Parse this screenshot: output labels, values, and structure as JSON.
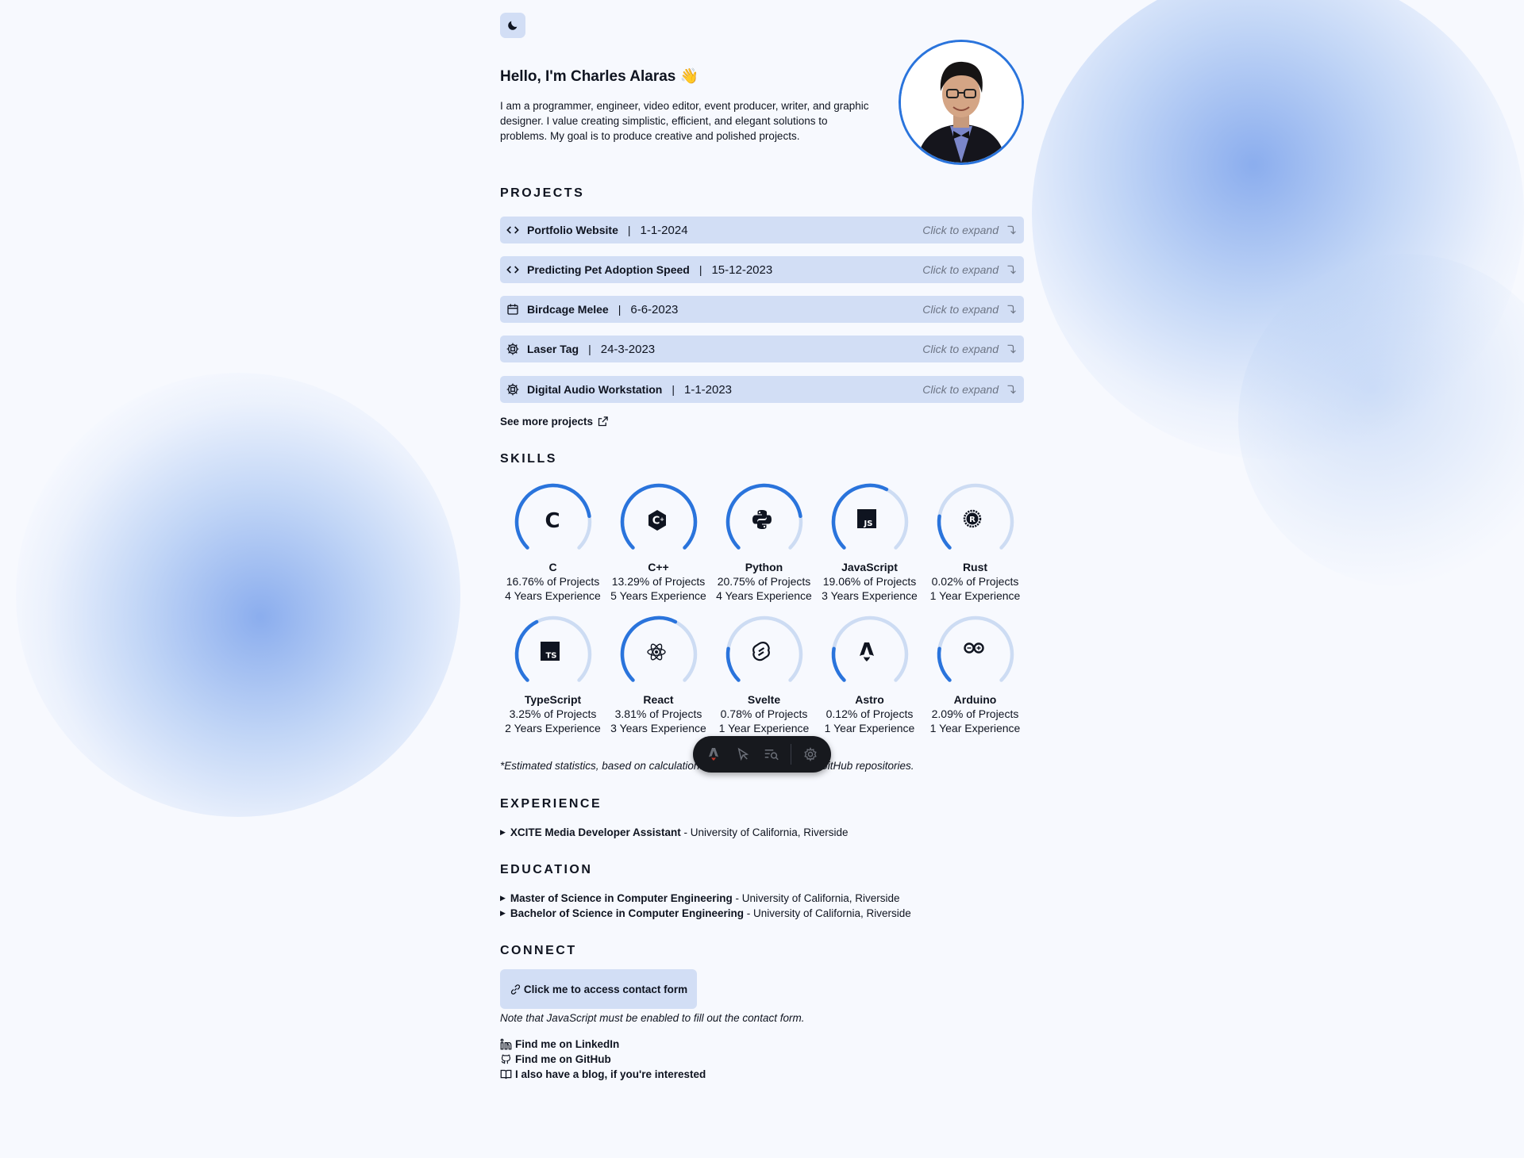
{
  "theme_toggle": {
    "icon": "moon-icon"
  },
  "intro": {
    "greeting": "Hello, I'm Charles Alaras",
    "wave": "👋",
    "bio": "I am a programmer, engineer, video editor, event producer, writer, and graphic designer. I value creating simplistic, efficient, and elegant solutions to problems. My goal is to produce creative and polished projects."
  },
  "projects": {
    "title": "PROJECTS",
    "expand_label": "Click to expand",
    "separator": "|",
    "items": [
      {
        "name": "Portfolio Website",
        "date": "1-1-2024",
        "icon": "code-icon"
      },
      {
        "name": "Predicting Pet Adoption Speed",
        "date": "15-12-2023",
        "icon": "code-icon"
      },
      {
        "name": "Birdcage Melee",
        "date": "6-6-2023",
        "icon": "calendar-icon"
      },
      {
        "name": "Laser Tag",
        "date": "24-3-2023",
        "icon": "cpu-icon"
      },
      {
        "name": "Digital Audio Workstation",
        "date": "1-1-2023",
        "icon": "cpu-icon"
      }
    ],
    "see_more": "See more projects"
  },
  "skills": {
    "title": "SKILLS",
    "items": [
      {
        "name": "C",
        "pct_text": "16.76% of Projects",
        "years_text": "4 Years Experience",
        "years": 4,
        "icon": "c-icon"
      },
      {
        "name": "C++",
        "pct_text": "13.29% of Projects",
        "years_text": "5 Years Experience",
        "years": 5,
        "icon": "cpp-icon"
      },
      {
        "name": "Python",
        "pct_text": "20.75% of Projects",
        "years_text": "4 Years Experience",
        "years": 4,
        "icon": "python-icon"
      },
      {
        "name": "JavaScript",
        "pct_text": "19.06% of Projects",
        "years_text": "3 Years Experience",
        "years": 3,
        "icon": "javascript-icon"
      },
      {
        "name": "Rust",
        "pct_text": "0.02% of Projects",
        "years_text": "1 Year Experience",
        "years": 1,
        "icon": "rust-icon"
      },
      {
        "name": "TypeScript",
        "pct_text": "3.25% of Projects",
        "years_text": "2 Years Experience",
        "years": 2,
        "icon": "typescript-icon"
      },
      {
        "name": "React",
        "pct_text": "3.81% of Projects",
        "years_text": "3 Years Experience",
        "years": 3,
        "icon": "react-icon"
      },
      {
        "name": "Svelte",
        "pct_text": "0.78% of Projects",
        "years_text": "1 Year Experience",
        "years": 1,
        "icon": "svelte-icon"
      },
      {
        "name": "Astro",
        "pct_text": "0.12% of Projects",
        "years_text": "1 Year Experience",
        "years": 1,
        "icon": "astro-icon"
      },
      {
        "name": "Arduino",
        "pct_text": "2.09% of Projects",
        "years_text": "1 Year Experience",
        "years": 1,
        "icon": "arduino-icon"
      }
    ],
    "note": "*Estimated statistics, based on calculations from public and private GitHub repositories."
  },
  "experience": {
    "title": "EXPERIENCE",
    "items": [
      {
        "role": "XCITE Media Developer Assistant",
        "org": " - University of California, Riverside"
      }
    ]
  },
  "education": {
    "title": "EDUCATION",
    "items": [
      {
        "degree": "Master of Science in Computer Engineering",
        "org": " - University of California, Riverside"
      },
      {
        "degree": "Bachelor of Science in Computer Engineering",
        "org": " - University of California, Riverside"
      }
    ]
  },
  "connect": {
    "title": "CONNECT",
    "contact_button": "Click me to access contact form",
    "contact_note": "Note that JavaScript must be enabled to fill out the contact form.",
    "links": [
      {
        "label": "Find me on LinkedIn",
        "icon": "linkedin-icon"
      },
      {
        "label": "Find me on GitHub",
        "icon": "github-icon"
      },
      {
        "label": "I also have a blog, if you're interested",
        "icon": "book-icon"
      }
    ]
  },
  "dev_toolbar": {
    "items": [
      "astro-menu-icon",
      "inspect-icon",
      "audit-icon",
      "settings-icon"
    ]
  },
  "colors": {
    "accent": "#2a74dc",
    "accent_light": "#cddcf3",
    "card_bg": "#d2def5",
    "page_bg": "#f7f9fe"
  }
}
